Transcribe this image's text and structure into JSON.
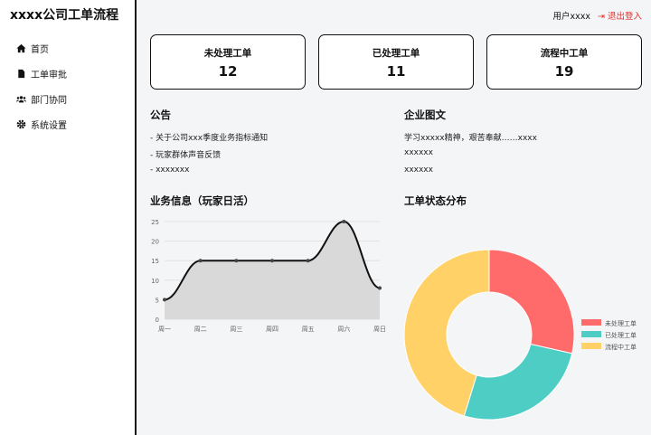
{
  "app": {
    "title": "xxxx公司工单流程"
  },
  "sidebar": {
    "items": [
      {
        "label": "首页",
        "icon": "home-icon"
      },
      {
        "label": "工单审批",
        "icon": "file-icon"
      },
      {
        "label": "部门协同",
        "icon": "users-icon"
      },
      {
        "label": "系统设置",
        "icon": "gear-icon"
      }
    ]
  },
  "topbar": {
    "user": "用户xxxx",
    "logout": "退出登入"
  },
  "cards": [
    {
      "title": "未处理工单",
      "value": "12"
    },
    {
      "title": "已处理工单",
      "value": "11"
    },
    {
      "title": "流程中工单",
      "value": "19"
    }
  ],
  "notice": {
    "title": "公告",
    "items": [
      "- 关于公司xxx季度业务指标通知",
      "- 玩家群体声音反馈",
      "- xxxxxxx"
    ]
  },
  "culture": {
    "title": "企业图文",
    "items": [
      "学习xxxxx精神，艰苦奉献……xxxx",
      "xxxxxx",
      "xxxxxx"
    ]
  },
  "colors": {
    "red": "#ff6b6b",
    "teal": "#4ecdc4",
    "yellow": "#ffd166"
  },
  "chart_data": [
    {
      "type": "area",
      "title": "业务信息（玩家日活）",
      "categories": [
        "周一",
        "周二",
        "周三",
        "周四",
        "周五",
        "周六",
        "周日"
      ],
      "values": [
        5,
        15,
        15,
        15,
        15,
        25,
        8
      ],
      "ylim": [
        0,
        25
      ],
      "yticks": [
        0,
        5,
        10,
        15,
        20,
        25
      ],
      "grid": true
    },
    {
      "type": "pie",
      "title": "工单状态分布",
      "categories": [
        "未处理工单",
        "已处理工单",
        "流程中工单"
      ],
      "values": [
        12,
        11,
        19
      ],
      "legend": "right",
      "donut": true
    }
  ]
}
